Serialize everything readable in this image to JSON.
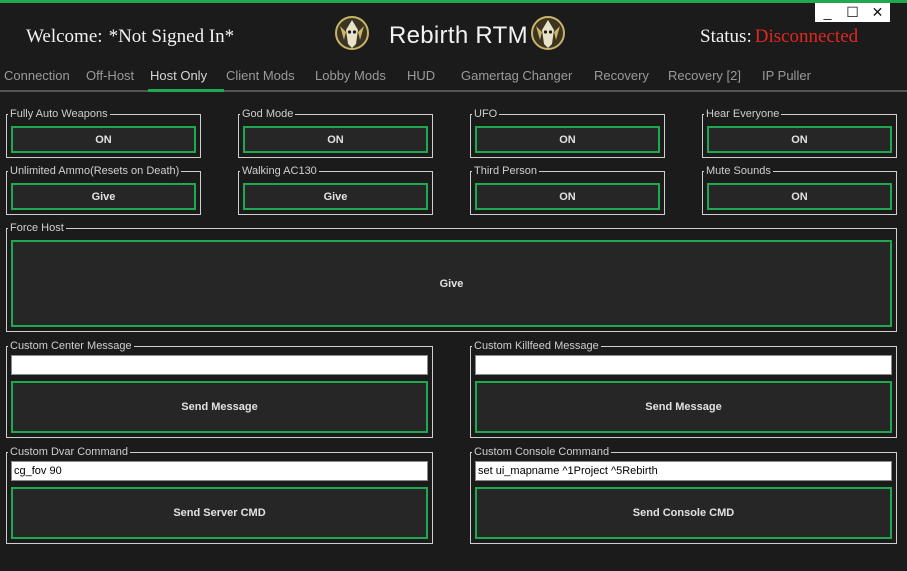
{
  "header": {
    "welcome_label": "Welcome:",
    "user_name": "*Not Signed In*",
    "title": "Rebirth RTM",
    "status_label": "Status:",
    "status_value": "Disconnected"
  },
  "window_controls": {
    "minimize": "_",
    "maximize": "☐",
    "close": "✕"
  },
  "tabs": [
    {
      "label": "Connection"
    },
    {
      "label": "Off-Host"
    },
    {
      "label": "Host Only",
      "active": true
    },
    {
      "label": "Client Mods"
    },
    {
      "label": "Lobby Mods"
    },
    {
      "label": "HUD"
    },
    {
      "label": "Gamertag Changer"
    },
    {
      "label": "Recovery"
    },
    {
      "label": "Recovery [2]"
    },
    {
      "label": "IP Puller"
    }
  ],
  "toggles": [
    {
      "label": "Fully Auto Weapons",
      "button": "ON"
    },
    {
      "label": "God Mode",
      "button": "ON"
    },
    {
      "label": "UFO",
      "button": "ON"
    },
    {
      "label": "Hear Everyone",
      "button": "ON"
    },
    {
      "label": "Unlimited Ammo(Resets on Death)",
      "button": "Give"
    },
    {
      "label": "Walking AC130",
      "button": "Give"
    },
    {
      "label": "Third Person",
      "button": "ON"
    },
    {
      "label": "Mute Sounds",
      "button": "ON"
    }
  ],
  "force_host": {
    "label": "Force Host",
    "button": "Give"
  },
  "center_message": {
    "label": "Custom Center Message",
    "value": "",
    "button": "Send Message"
  },
  "killfeed_message": {
    "label": "Custom Killfeed Message",
    "value": "",
    "button": "Send Message"
  },
  "dvar_command": {
    "label": "Custom Dvar Command",
    "value": "cg_fov 90",
    "button": "Send Server CMD"
  },
  "console_command": {
    "label": "Custom Console Command",
    "value": "set ui_mapname ^1Project ^5Rebirth",
    "button": "Send Console CMD"
  },
  "colors": {
    "accent": "#1fa84f",
    "status_error": "#e0281f",
    "background": "#1b1b1b"
  },
  "icons": {
    "logo": "rebirth-logo-icon"
  }
}
